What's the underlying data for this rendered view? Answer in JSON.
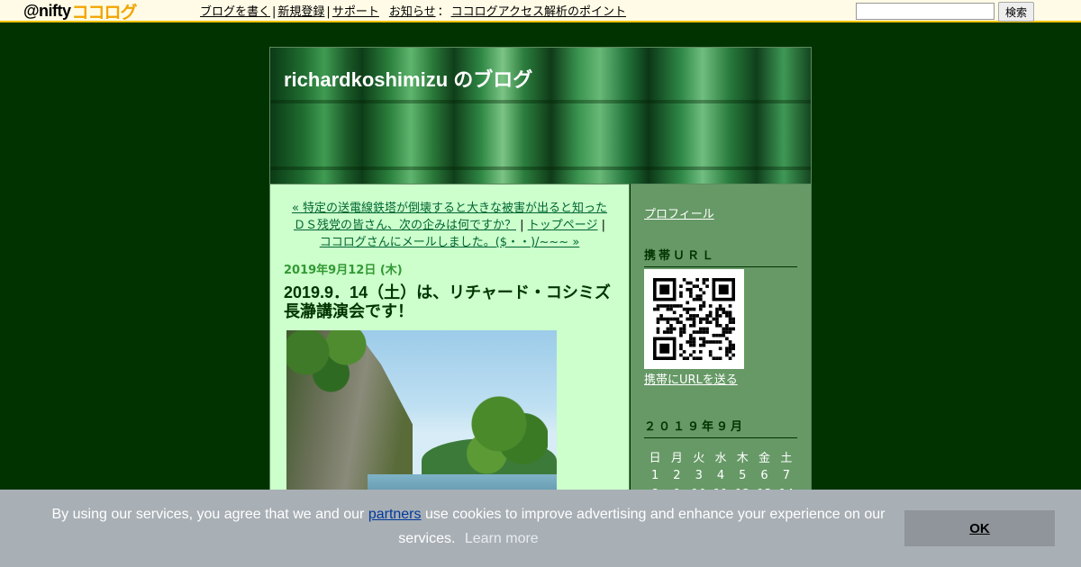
{
  "topbar": {
    "logo_at": "@nifty",
    "logo_kana": "ココログ",
    "nav": [
      "ブログを書く",
      "新規登録",
      "サポート"
    ],
    "notice_label": "お知らせ",
    "notice_link": "ココログアクセス解析のポイント",
    "search_placeholder": "",
    "search_button": "検索"
  },
  "blog": {
    "title": "richardkoshimizu のブログ"
  },
  "entry_nav": {
    "prev": "« 特定の送電線鉄塔が倒壊すると大きな被害が出ると知ったＤＳ残党の皆さん、次の企みは何ですか？",
    "top": "トップページ",
    "next": "ココログさんにメールしました。($・・)/~~~ »"
  },
  "entry": {
    "date": "2019年9月12日 (木)",
    "title": "2019.9．14（土）は、リチャード・コシミズ長瀞講演会です！"
  },
  "sidebar": {
    "profile": "プロフィール",
    "mobile_heading": "携帯ＵＲＬ",
    "send_url": "携帯にURLを送る",
    "calendar_heading": "２０１９年９月",
    "weekdays": [
      "日",
      "月",
      "火",
      "水",
      "木",
      "金",
      "土"
    ],
    "weeks": [
      [
        "1",
        "2",
        "3",
        "4",
        "5",
        "6",
        "7"
      ],
      [
        "8",
        "9",
        "10",
        "11",
        "12",
        "13",
        "14"
      ]
    ]
  },
  "cookie": {
    "text_before": "By using our services, you agree that we and our",
    "partners": "partners",
    "text_after": "use cookies to improve advertising and enhance your experience on our services.",
    "learn_more": "Learn more",
    "ok": "OK"
  }
}
